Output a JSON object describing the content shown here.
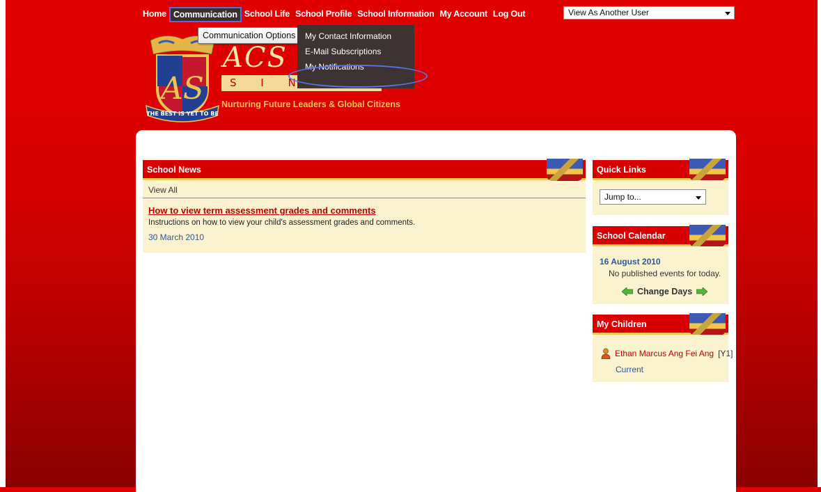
{
  "nav": {
    "items": [
      "Home",
      "Communication",
      "School Life",
      "School Profile",
      "School Information",
      "My Account",
      "Log Out"
    ],
    "active_index": 1
  },
  "view_as": {
    "value": "View As Another User"
  },
  "tooltip": {
    "text": "Communication Options"
  },
  "dropdown": {
    "items": [
      "My Contact Information",
      "E-Mail Subscriptions",
      "My Notifications"
    ],
    "highlighted": "My Notifications"
  },
  "logo": {
    "wordmark": "ACS (In",
    "country": "S I N G",
    "motto": "THE BEST IS YET TO BE",
    "tagline": "Nurturing Future Leaders & Global Citizens"
  },
  "news": {
    "heading": "School News",
    "view_all": "View All",
    "item_title": "How to view term assessment grades and comments",
    "item_desc": "Instructions on how to view your child's assessment grades and comments.",
    "item_date": "30 March 2010"
  },
  "quick_links": {
    "heading": "Quick Links",
    "select_value": "Jump to..."
  },
  "calendar": {
    "heading": "School Calendar",
    "date": "16 August 2010",
    "empty_text": "No published events for today.",
    "change_days": "Change Days"
  },
  "children": {
    "heading": "My Children",
    "name": "Ethan Marcus Ang Fei Ang",
    "grade": "[Y1]",
    "status": "Current"
  },
  "colors": {
    "brand_red": "#d80000",
    "gold": "#efc94f",
    "link_blue": "#2a5a9a",
    "panel_cream": "#fbf3cf"
  }
}
